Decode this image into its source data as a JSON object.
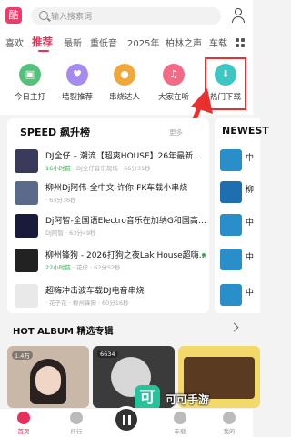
{
  "header": {
    "logo_glyph": "酷",
    "search_placeholder": "输入搜索词"
  },
  "tabs": [
    "喜欢",
    "推荐",
    "最新",
    "重低音",
    "2025年",
    "柏林之声",
    "车载"
  ],
  "active_tab": "推荐",
  "shortcuts": [
    {
      "label": "今日主打",
      "color": "#55c07a",
      "icon": "calendar-icon",
      "glyph": "▣"
    },
    {
      "label": "墙裂推荐",
      "color": "#a58bf0",
      "icon": "thumbs-up-icon",
      "glyph": "♥"
    },
    {
      "label": "串烧达人",
      "color": "#f0a83a",
      "icon": "person-icon",
      "glyph": "●"
    },
    {
      "label": "大家在听",
      "color": "#f26a86",
      "icon": "headphones-icon",
      "glyph": "♫"
    },
    {
      "label": "热门下载",
      "color": "#3ec6c4",
      "icon": "download-icon",
      "glyph": "⬇"
    }
  ],
  "speed": {
    "title": "SPEED 飙升榜",
    "more": "更多",
    "songs": [
      {
        "title": "DJ全仔 – 潮流【超爽HOUSE】26年最新…",
        "time": "16小时前",
        "meta": " · DJ全仔音乐现场 · 66分31秒",
        "cover": "#3a3a5a"
      },
      {
        "title": "柳州Dj阿伟-全中文-许你-FK车载小串烧",
        "time": "",
        "meta": "· 63分36秒",
        "cover": "#5a6a8a"
      },
      {
        "title": "Dj阿智-全国语Electro音乐在加纳G和国高…",
        "time": "",
        "meta": "DJ阿智 · 63分49秒",
        "cover": "#1a1a3a"
      },
      {
        "title": "柳州锋狗 - 2026打狗之夜Lak House超嗨…",
        "time": "22小时前",
        "meta": " · 花仔 · 62分52秒",
        "cover": "#222222"
      },
      {
        "title": "超嗨冲击波车载DJ电音串烧",
        "time": "",
        "meta": "· 花子花 · 柳州锋狗 · 60分16秒",
        "cover": "#e9e9e9"
      }
    ]
  },
  "newest": {
    "title": "NEWEST",
    "items": [
      "中",
      "柳",
      "中",
      "中",
      "中"
    ]
  },
  "album": {
    "title": "HOT ALBUM 精选专辑",
    "cards": [
      {
        "count": "1.4万",
        "color": "#c9b8a8"
      },
      {
        "count": "6634",
        "color": "#3b3b3b"
      },
      {
        "count": "",
        "color": "#f2d96a"
      }
    ]
  },
  "bottom_nav": [
    {
      "label": "首页",
      "active": true
    },
    {
      "label": "排行",
      "active": false
    },
    {
      "label": "",
      "active": false
    },
    {
      "label": "车载",
      "active": false
    },
    {
      "label": "我的",
      "active": false
    }
  ],
  "watermark": {
    "glyph": "可",
    "text": "可可手游"
  }
}
